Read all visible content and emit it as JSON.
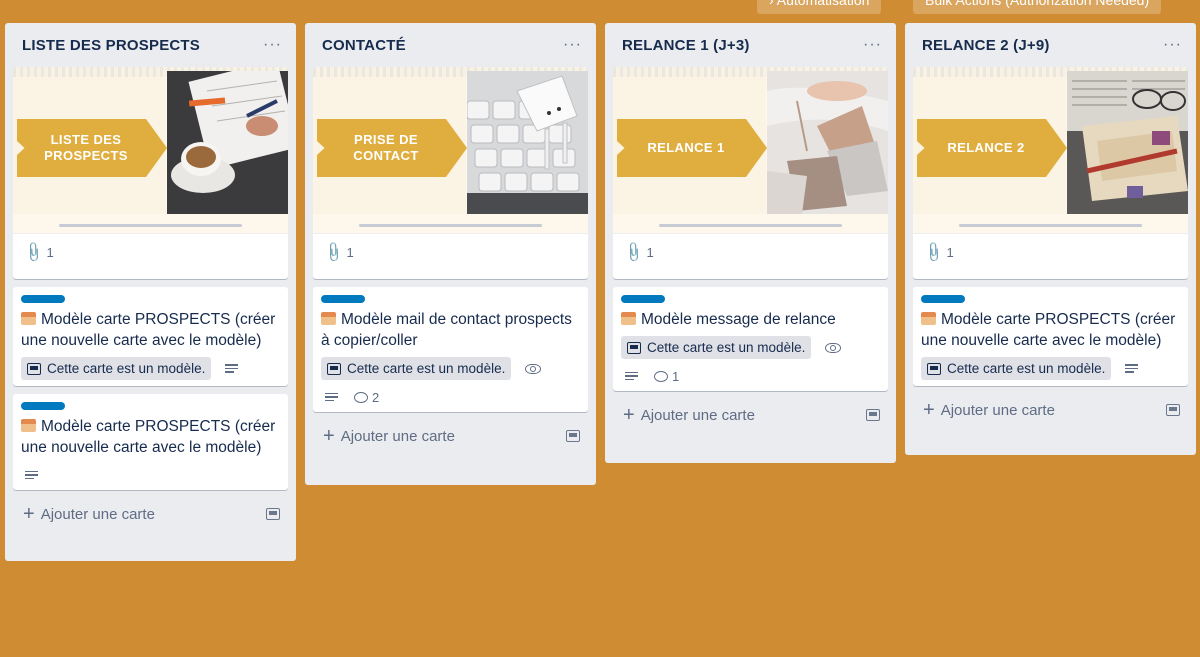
{
  "header": {
    "automation_label": "Automatisation",
    "bulk_actions_label": "Bulk Actions (Authorization Needed)"
  },
  "lists": [
    {
      "title": "LISTE DES PROSPECTS",
      "cover_text_line1": "LISTE DES",
      "cover_text_line2": "PROSPECTS",
      "attachments": "1",
      "cards": [
        {
          "title": "Modèle carte PROSPECTS (créer une nouvelle carte avec le modèle)",
          "template_badge": "Cette carte est un modèle."
        },
        {
          "title": "Modèle carte PROSPECTS (créer une nouvelle carte avec le modèle)"
        }
      ],
      "add_card": "Ajouter une carte"
    },
    {
      "title": "CONTACTÉ",
      "cover_text_line1": "PRISE DE",
      "cover_text_line2": "CONTACT",
      "attachments": "1",
      "cards": [
        {
          "title": "Modèle mail de contact prospects à copier/coller",
          "template_badge": "Cette carte est un modèle.",
          "comments": "2"
        }
      ],
      "add_card": "Ajouter une carte"
    },
    {
      "title": "RELANCE 1 (J+3)",
      "cover_text_line1": "RELANCE  1",
      "cover_text_line2": "",
      "attachments": "1",
      "cards": [
        {
          "title": "Modèle message de relance",
          "template_badge": "Cette carte est un modèle.",
          "comments": "1"
        }
      ],
      "add_card": "Ajouter une carte"
    },
    {
      "title": "RELANCE 2 (J+9)",
      "cover_text_line1": "RELANCE  2",
      "cover_text_line2": "",
      "attachments": "1",
      "cards": [
        {
          "title": "Modèle carte PROSPECTS (créer une nouvelle carte avec le modèle)",
          "template_badge": "Cette carte est un modèle."
        }
      ],
      "add_card": "Ajouter une carte"
    }
  ],
  "colors": {
    "board_background": "#D08C32",
    "list_background": "#EBECF0",
    "label_blue": "#0079BF",
    "cover_banner": "#E0AE3E"
  }
}
